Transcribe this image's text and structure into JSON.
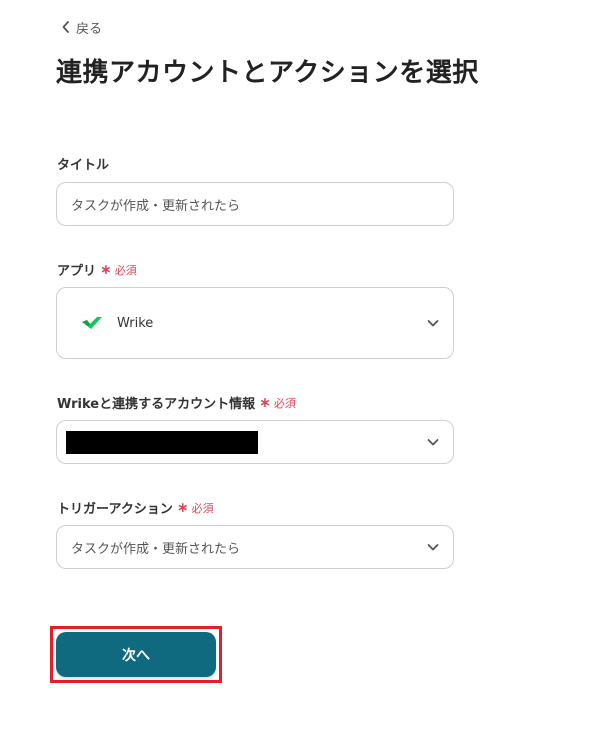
{
  "back": {
    "label": "戻る"
  },
  "page": {
    "title": "連携アカウントとアクションを選択"
  },
  "required_text": "必須",
  "fields": {
    "title": {
      "label": "タイトル",
      "value": "タスクが作成・更新されたら"
    },
    "app": {
      "label": "アプリ",
      "selected": "Wrike",
      "icon": "wrike-logo-icon"
    },
    "account": {
      "label": "Wrikeと連携するアカウント情報",
      "value_redacted": true
    },
    "trigger": {
      "label": "トリガーアクション",
      "selected": "タスクが作成・更新されたら"
    }
  },
  "actions": {
    "next_label": "次へ"
  },
  "colors": {
    "primary_button": "#0f6a80",
    "required": "#e0465a",
    "highlight": "#e2202a",
    "wrike_green": "#1fc05f"
  }
}
